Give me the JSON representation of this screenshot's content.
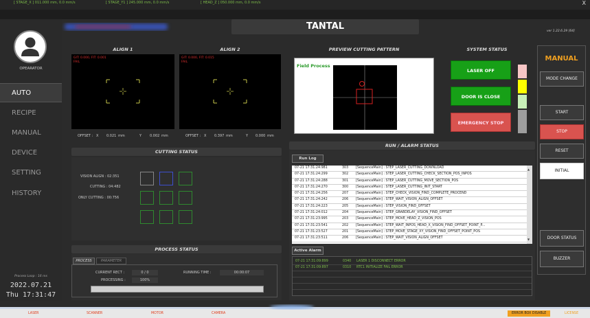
{
  "window": {
    "close_label": "X"
  },
  "topbar": {
    "stage_x": "[ STAGE_X ]  011.000 mm, 0.0 mm/s",
    "stage_y1": "[ STAGE_Y1 ]  245.000 mm, 0.0 mm/s",
    "head_z": "[ HEAD_Z ]  050.000 mm, 0.0 mm/s"
  },
  "header": {
    "title": "TANTAL",
    "version": "ver 1.22.6.29 [64]"
  },
  "user": {
    "role": "OPEARATOR"
  },
  "sidebar": {
    "items": [
      {
        "label": "AUTO",
        "active": true
      },
      {
        "label": "RECIPE"
      },
      {
        "label": "MANUAL"
      },
      {
        "label": "DEVICE"
      },
      {
        "label": "SETTING"
      },
      {
        "label": "HISTORY"
      }
    ]
  },
  "footer": {
    "loop": "Process Loop : 16 ms",
    "date": "2022.07.21",
    "time": "Thu 17:31:47"
  },
  "align1": {
    "title": "ALIGN 1",
    "info": "GIT: 0.000, FIT: 0.001",
    "fail": "FAIL",
    "offset_label": "OFFSET :",
    "x_label": "X",
    "x_value": "0.021",
    "y_label": "Y",
    "y_value": "0.002",
    "unit": "mm"
  },
  "align2": {
    "title": "ALIGN 2",
    "info": "GIT: 0.000, FIT: 0.015",
    "fail": "FAIL",
    "offset_label": "OFFSET :",
    "x_label": "X",
    "x_value": "0.397",
    "y_label": "Y",
    "y_value": "0.000",
    "unit": "mm"
  },
  "preview": {
    "title": "PREVIEW CUTTING PATTERN",
    "field_label": "Field Process"
  },
  "system_status": {
    "title": "SYSTEM STATUS",
    "laser": "LASER OFF",
    "door": "DOOR IS CLOSE",
    "emergency": "EMERGENCY STOP",
    "colors": {
      "green": "#17a017",
      "red_button": "#d9534f",
      "ind1": "#f7c6c6",
      "ind2": "#ffff00",
      "ind3": "#c8f0b8",
      "ind4": "#9e9e9e"
    }
  },
  "cutting_status": {
    "title": "CUTTING STATUS",
    "vision_align": "VISION ALIGN : 02:351",
    "cutting": "CUTTING : 04:482",
    "only_cutting": "ONLY CUTTING : 00:756"
  },
  "run_alarm": {
    "title": "RUN / ALARM STATUS",
    "run_log_tab": "Run Log",
    "active_alarm_tab": "Active Alarm",
    "log_rows": [
      {
        "time": "07-21 17:31:24:981",
        "code": "303",
        "msg": "[SequenceMain] : STEP_LASER_CUTTING_DOWNLOAD"
      },
      {
        "time": "07-21 17:31:24:299",
        "code": "302",
        "msg": "[SequenceMain] : STEP_LASER_CUTTING_CHECK_SECTION_POS_INPOS"
      },
      {
        "time": "07-21 17:31:24:288",
        "code": "301",
        "msg": "[SequenceMain] : STEP_LASER_CUTTING_MOVE_SECTION_POS"
      },
      {
        "time": "07-21 17:31:24:270",
        "code": "300",
        "msg": "[SequenceMain] : STEP_LASER_CUTTING_INIT_START"
      },
      {
        "time": "07-21 17:31:24:256",
        "code": "207",
        "msg": "[SequenceMain] : STEP_CHECK_VISION_FIND_COMPLETE_PROCEND"
      },
      {
        "time": "07-21 17:31:24:242",
        "code": "206",
        "msg": "[SequenceMain] : STEP_WAIT_VISION_ALIGN_OFFSET"
      },
      {
        "time": "07-21 17:31:24:223",
        "code": "205",
        "msg": "[SequenceMain] : STEP_VISION_FIND_OFFSET"
      },
      {
        "time": "07-21 17:31:24:012",
        "code": "204",
        "msg": "[SequenceMain] : STEP_GRABDELAY_VISION_FIND_OFFSET"
      },
      {
        "time": "07-21 17:31:23:995",
        "code": "203",
        "msg": "[SequenceMain] : STEP_MOVE_HEAD_Z_VISION_POS"
      },
      {
        "time": "07-21 17:31:23:541",
        "code": "202",
        "msg": "[SequenceMain] : STEP_WAIT_INPOS_HEAD_X_VISION_FIND_OFFSET_POINT_P..."
      },
      {
        "time": "07-21 17:31:23:527",
        "code": "201",
        "msg": "[SequenceMain] : STEP_MOVE_STAGE_XY_VISION_FIND_OFFSET_POINT_POS"
      },
      {
        "time": "07-21 17:31:23:511",
        "code": "206",
        "msg": "[SequenceMain] : STEP_WAIT_VISION_ALIGN_OFFSET"
      }
    ],
    "alarm_rows": [
      {
        "time": "07-21 17:31:09:899",
        "code": "0340",
        "msg": "LASER 1 DISCONNECT ERROR"
      },
      {
        "time": "07-21 17:31:09:897",
        "code": "0310",
        "msg": "RTC1 INITIALIZE FAIL ERROR"
      }
    ]
  },
  "process_status": {
    "title": "PROCESS STATUS",
    "tab_process": "PROCESS",
    "tab_parameter": "PARAMETER",
    "current_rect_label": "CURRENT RECT :",
    "current_rect_value": "0 / 0",
    "running_time_label": "RUNNING TIME :",
    "running_time_value": "00:00:07",
    "processing_label": "PROCESSING :",
    "processing_value": "100%"
  },
  "right_panel": {
    "mode": "MANUAL",
    "mode_change": "MODE CHANGE",
    "start": "START",
    "stop": "STOP",
    "reset": "RESET",
    "initial": "INITIAL",
    "door_status": "DOOR STATUS",
    "buzzer": "BUZZER"
  },
  "statusbar": {
    "laser": "LASER",
    "scanner": "SCANNER",
    "motor": "MOTOR",
    "camera": "CAMERA",
    "error_box": "ERROR BOX DISABLE",
    "license": "LICENSE"
  }
}
